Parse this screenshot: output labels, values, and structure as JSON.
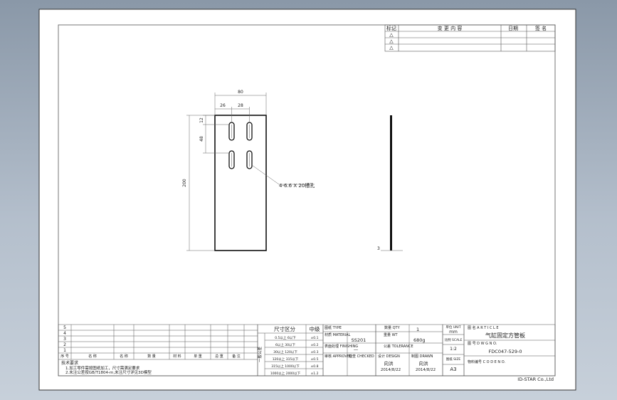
{
  "revision_table": {
    "headers": [
      "标记",
      "变 更 内 容",
      "日期",
      "签 名"
    ],
    "marks": [
      "△",
      "△",
      "△"
    ]
  },
  "drawing": {
    "dims": {
      "total_width": "80",
      "left_offset": "26",
      "slot_spacing_x": "28",
      "top_offset": "12",
      "slot_spacing_y": "48",
      "total_height": "200",
      "thickness": "3"
    },
    "callout": "4-6.6 X 20槽孔"
  },
  "titleblock": {
    "left_rows": [
      "5",
      "4",
      "3",
      "2",
      "1"
    ],
    "left_header": [
      "序 号",
      "名 称",
      "名 称",
      "数 量",
      "材 料",
      "单 重",
      "总 重",
      "备 注"
    ],
    "notes": [
      "技术要求",
      "1.加工零件需按图纸加工，尺寸需满足要求",
      "2.未注公差按GB/T1804-m,未注尺寸详见3D模型"
    ],
    "tolerance": {
      "col_size": "尺寸区分",
      "col_grade": "中级",
      "side_label": "一般公差",
      "rows": [
        {
          "range": "0.5以上 6以下",
          "val": "±0.1"
        },
        {
          "range": "6以上 30以下",
          "val": "±0.2"
        },
        {
          "range": "30以上 120以下",
          "val": "±0.3"
        },
        {
          "range": "120以上 315以下",
          "val": "±0.5"
        },
        {
          "range": "315以上 1000以下",
          "val": "±0.8"
        },
        {
          "range": "1000以上 2000以下",
          "val": "±1.2"
        }
      ]
    },
    "type_label": "图纸 TYPE",
    "material_label": "材质 MATERIAL",
    "material": "SS201",
    "surface_label": "表面处理 FINISHING",
    "surface": "—",
    "qty_label": "数量 QTY",
    "qty": "1",
    "weight_label": "重量 WT",
    "weight": "680g",
    "tolerance_label": "公差 TOLERANCE",
    "approved_label": "审核 APPROVED",
    "checked_label": "检查 CHECKED",
    "designed_label": "设计 DESIGN",
    "drawn_label": "制图 DRAWN",
    "checked_name": "向洪",
    "drawn_name": "向洪",
    "checked_date": "2014/8/22",
    "drawn_date": "2014/8/22",
    "unit_label": "单位 UNIT",
    "unit": "mm",
    "scale_label": "比例 SCALE",
    "scale": "1:2",
    "size_label": "图纸 SIZE",
    "size": "A3",
    "title_label": "图 名 A R T I C L E",
    "title": "气缸固定方管板",
    "dwg_label": "图 号 D W G N O.",
    "dwg_no": "FDC047-529-0",
    "code_label": "物料编号 C O D E N O.",
    "company": "ID-STAR Co.,Ltd"
  }
}
